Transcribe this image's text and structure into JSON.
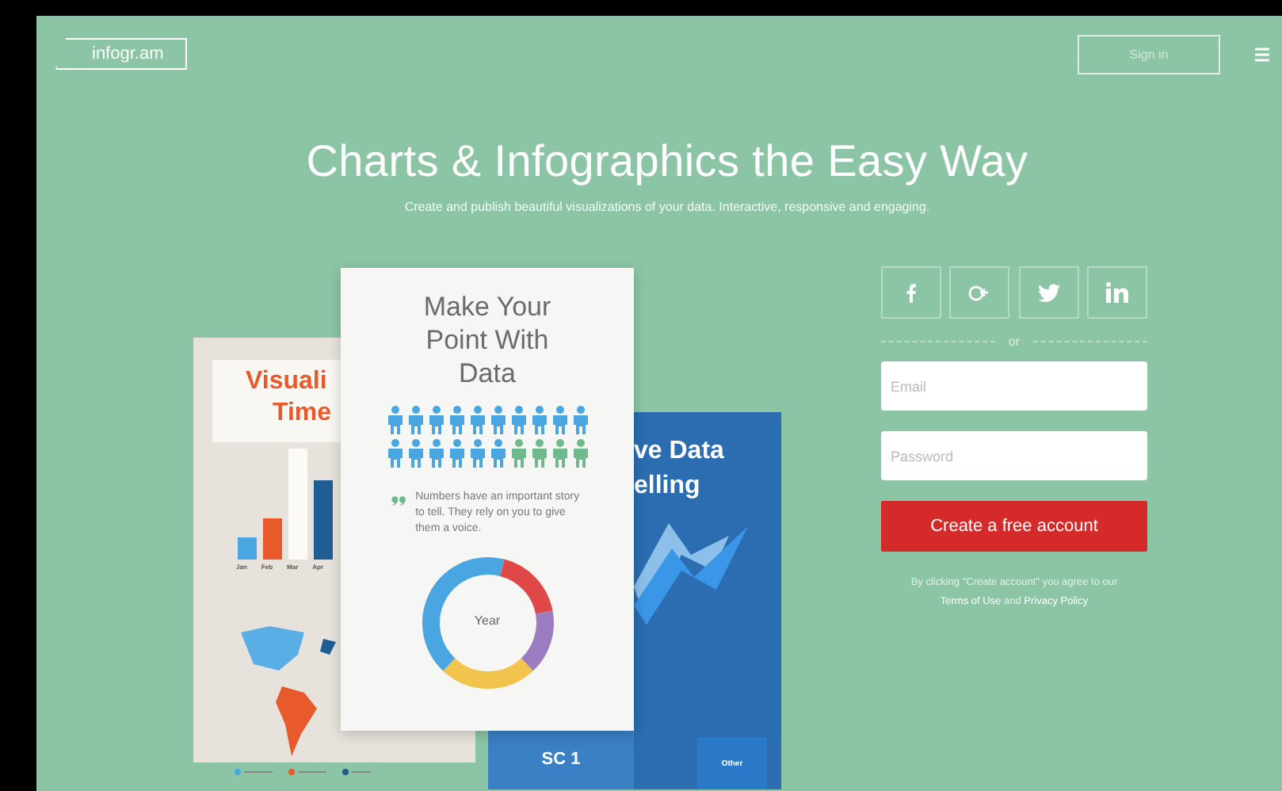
{
  "header": {
    "logo": "infogr.am",
    "sign_in": "Sign in"
  },
  "hero": {
    "title": "Charts & Infographics the Easy Way",
    "subtitle": "Create and publish beautiful visualizations of your data. Interactive, responsive and engaging."
  },
  "showcase": {
    "left_card": {
      "title_lines": [
        "Visuali",
        "Time"
      ],
      "months": [
        "Jan",
        "Feb",
        "Mar",
        "Apr"
      ]
    },
    "front_card": {
      "title": "Make Your Point With Data",
      "quote": "Numbers have an important story to tell. They rely on you to give them a voice.",
      "donut_label": "Year",
      "people": [
        {
          "color": "#4aa6e0"
        },
        {
          "color": "#4aa6e0"
        },
        {
          "color": "#4aa6e0"
        },
        {
          "color": "#4aa6e0"
        },
        {
          "color": "#4aa6e0"
        },
        {
          "color": "#4aa6e0"
        },
        {
          "color": "#4aa6e0"
        },
        {
          "color": "#4aa6e0"
        },
        {
          "color": "#4aa6e0"
        },
        {
          "color": "#4aa6e0"
        },
        {
          "color": "#4aa6e0"
        },
        {
          "color": "#4aa6e0"
        },
        {
          "color": "#4aa6e0"
        },
        {
          "color": "#4aa6e0"
        },
        {
          "color": "#4aa6e0"
        },
        {
          "color": "#4aa6e0"
        },
        {
          "color": "#6fba8c"
        },
        {
          "color": "#6fba8c"
        },
        {
          "color": "#6fba8c"
        },
        {
          "color": "#6fba8c"
        }
      ]
    },
    "blue_card": {
      "title_lines": [
        "ve Data",
        "elling"
      ],
      "tiles": [
        "SC 1",
        "Other"
      ]
    }
  },
  "signup": {
    "social": [
      {
        "kind": "facebook"
      },
      {
        "kind": "google"
      },
      {
        "kind": "twitter"
      },
      {
        "kind": "linkedin"
      }
    ],
    "or": "or",
    "email": {
      "placeholder": "Email"
    },
    "password": {
      "placeholder": "Password"
    },
    "button": "Create a free account",
    "terms": {
      "prefix": "By clicking \"Create account\" you agree to our",
      "terms_link": "Terms of Use",
      "and": "and",
      "privacy_link": "Privacy Policy"
    }
  }
}
